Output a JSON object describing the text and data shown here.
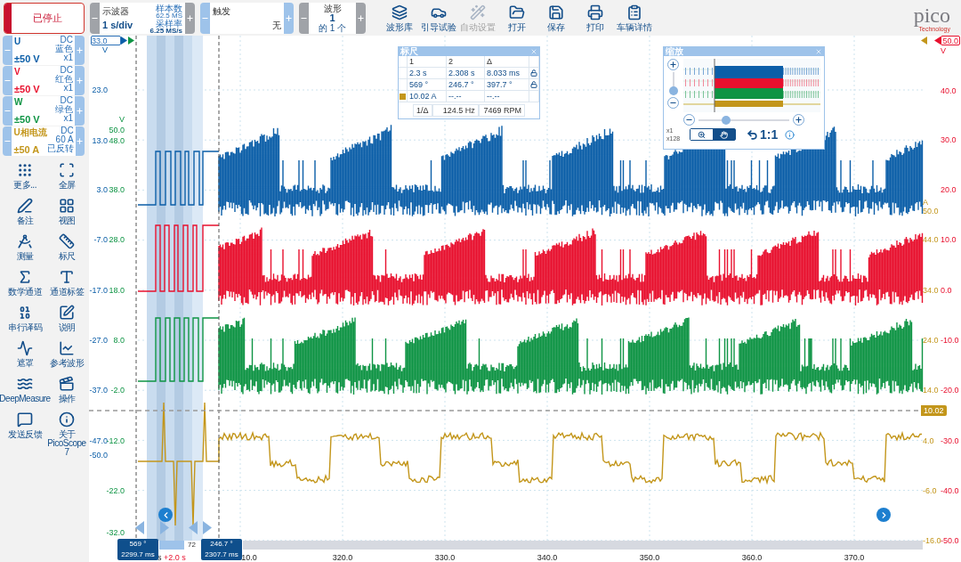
{
  "top_bar": {
    "run_button": {
      "label": "已停止"
    },
    "scope": {
      "title": "示波器",
      "timebase": "1 s/div",
      "samples_label": "样本数",
      "samples": "62.5 MS",
      "rate_label": "采样率",
      "rate": "6.25 MS/s"
    },
    "trigger": {
      "title": "触发",
      "mode": "无"
    },
    "waveform": {
      "title": "波形",
      "current": "1",
      "count": "的 1 个"
    },
    "tools": [
      {
        "label": "波形库",
        "kind": "library",
        "disabled": false
      },
      {
        "label": "引导试验",
        "kind": "car",
        "disabled": false
      },
      {
        "label": "自动设置",
        "kind": "wand",
        "disabled": true
      },
      {
        "label": "打开",
        "kind": "open",
        "disabled": false
      },
      {
        "label": "保存",
        "kind": "save",
        "disabled": false
      },
      {
        "label": "打印",
        "kind": "print",
        "disabled": false
      },
      {
        "label": "车辆详情",
        "kind": "clipboard",
        "disabled": false
      }
    ],
    "logo": {
      "name": "pico",
      "tagline": "Technology"
    }
  },
  "channels": [
    {
      "name": "U",
      "color": "#0b5ea8",
      "details": [
        "DC",
        "蓝色",
        "x1"
      ],
      "range": "±50 V"
    },
    {
      "name": "V",
      "color": "#e8102e",
      "details": [
        "DC",
        "红色",
        "x1"
      ],
      "range": "±50 V"
    },
    {
      "name": "W",
      "color": "#0e9444",
      "details": [
        "DC",
        "绿色",
        "x1"
      ],
      "range": "±50 V"
    },
    {
      "name": "U相电流",
      "color": "#c3961b",
      "details": [
        "DC",
        "60 A",
        "已反转"
      ],
      "range": "±50 A"
    }
  ],
  "side_tools": [
    {
      "label": "更多...",
      "kind": "dots"
    },
    {
      "label": "全屏",
      "kind": "fullscreen"
    },
    {
      "label": "备注",
      "kind": "notes"
    },
    {
      "label": "视图",
      "kind": "views"
    },
    {
      "label": "测量",
      "kind": "measure"
    },
    {
      "label": "标尺",
      "kind": "ruler"
    },
    {
      "label": "数学通道",
      "kind": "math"
    },
    {
      "label": "通道标签",
      "kind": "labels"
    },
    {
      "label": "串行译码",
      "kind": "serial"
    },
    {
      "label": "说明",
      "kind": "edit"
    },
    {
      "label": "遮罩",
      "kind": "mask"
    },
    {
      "label": "参考波形",
      "kind": "reference"
    },
    {
      "label": "DeepMeasure",
      "kind": "deep"
    },
    {
      "label": "操作",
      "kind": "actions"
    },
    {
      "label": "发送反馈",
      "kind": "feedback"
    },
    {
      "label": "关于 PicoScope 7",
      "kind": "about"
    }
  ],
  "axes": [
    {
      "color": "#0b5ea8",
      "unit": "V",
      "top_marker": "33.0",
      "ticks": [
        "23.0",
        "13.0",
        "3.0",
        "-7.0",
        "-17.0",
        "-27.0",
        "-37.0",
        "-47.0",
        "-50.0"
      ]
    },
    {
      "color": "#0e9444",
      "unit": "V",
      "ticks": [
        "50.0",
        "48.0",
        "38.0",
        "28.0",
        "18.0",
        "8.0",
        "-2.0",
        "-12.0",
        "-22.0",
        "-32.0"
      ]
    },
    {
      "color": "#c3961b",
      "unit": "A",
      "ticks": [
        "50.0",
        "44.0",
        "34.0",
        "24.0",
        "14.0",
        "4.0",
        "-6.0",
        "-16.0"
      ]
    },
    {
      "color": "#e8102e",
      "unit": "V",
      "top_marker": "50.0",
      "ticks": [
        "40.0",
        "30.0",
        "20.0",
        "10.0",
        "0.0",
        "-10.0",
        "-20.0",
        "-30.0",
        "-40.0",
        "-50.0"
      ]
    }
  ],
  "level_marker": "10.02",
  "x_axis": {
    "ticks": [
      "10.0",
      "320.0",
      "330.0",
      "340.0",
      "350.0",
      "360.0",
      "370.0"
    ],
    "unit_fragment": "s",
    "offset": "+2.0 s",
    "scroll_fragment": "72"
  },
  "ruler_tags": [
    {
      "phase": "569 °",
      "time": "2299.7 ms"
    },
    {
      "phase": "246.7 °",
      "time": "2307.7 ms"
    }
  ],
  "ruler_panel": {
    "title": "标尺",
    "header": [
      "1",
      "2",
      "Δ"
    ],
    "rows": [
      {
        "cells": [
          "2.3 s",
          "2.308 s",
          "8.033 ms"
        ],
        "locked": true
      },
      {
        "cells": [
          "569 °",
          "246.7 °",
          "397.7 °"
        ],
        "locked": true
      },
      {
        "cells": [
          "10.02 A",
          "--.--",
          "--.--"
        ],
        "locked": false,
        "color": "#c3961b"
      }
    ],
    "footer": [
      "1/Δ",
      "124.5 Hz",
      "7469 RPM"
    ]
  },
  "zoom_panel": {
    "title": "缩放",
    "vertical": {
      "level": 0.2
    },
    "horizontal": {
      "level": 0.3
    },
    "scales": [
      "x1",
      "x128"
    ],
    "modes": [
      {
        "kind": "zoom",
        "selected": false
      },
      {
        "kind": "pan",
        "selected": true
      }
    ],
    "reset": "1:1"
  }
}
